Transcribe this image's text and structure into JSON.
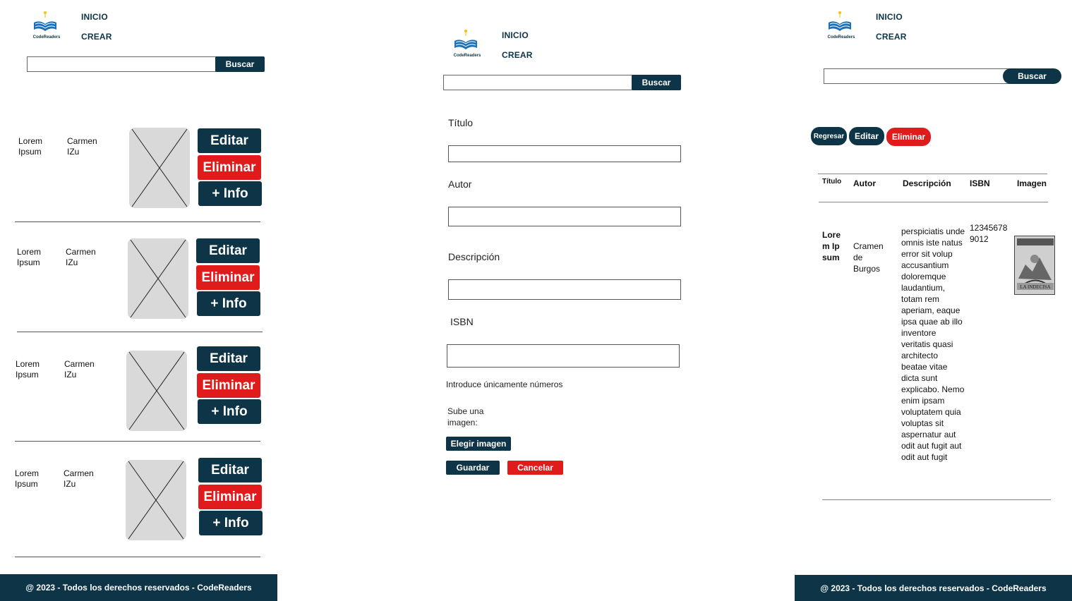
{
  "logo_text": "CodeReaders",
  "nav": {
    "inicio": "INICIO",
    "crear": "CREAR"
  },
  "search": {
    "button": "Buscar",
    "value": ""
  },
  "colors": {
    "primary": "#0d3547",
    "danger": "#e01b1b",
    "placeholder": "#d9d9d9"
  },
  "list": {
    "actions": {
      "edit": "Editar",
      "delete": "Eliminar",
      "info": "+ Info"
    },
    "items": [
      {
        "title": "Lorem Ipsum",
        "author": "Carmen IZu"
      },
      {
        "title": "Lorem Ipsum",
        "author": "Carmen IZu"
      },
      {
        "title": "Lorem Ipsum",
        "author": "Carmen IZu"
      },
      {
        "title": "Lorem Ipsum",
        "author": "Carmen IZu"
      }
    ]
  },
  "form": {
    "title_label": "Título",
    "author_label": "Autor",
    "description_label": "Descripción",
    "isbn_label": "ISBN",
    "isbn_hint": "Introduce únicamente números",
    "upload_label": "Sube una imagen:",
    "choose_image": "Elegir imagen",
    "save": "Guardar",
    "cancel": "Cancelar"
  },
  "detail": {
    "buttons": {
      "back": "Regresar",
      "edit": "Editar",
      "delete": "Eliminar"
    },
    "headers": {
      "title": "Título",
      "author": "Autor",
      "description": "Descripción",
      "isbn": "ISBN",
      "image": "Imagen"
    },
    "row": {
      "title": "Lorem Ipsum",
      "author": "Cramen de Burgos",
      "description": "perspiciatis unde omnis iste natus error sit volup accusantium doloremque laudantium, totam rem aperiam, eaque ipsa quae ab illo inventore veritatis  quasi architecto beatae vitae dicta sunt explicabo. Nemo enim ipsam voluptatem quia voluptas sit aspernatur aut odit aut fugit aut odit aut fugit",
      "isbn": "123456789012",
      "image_caption": "LA INDECISA"
    }
  },
  "footer": {
    "text": "@ 2023 - Todos los derechos reservados - CodeReaders"
  }
}
